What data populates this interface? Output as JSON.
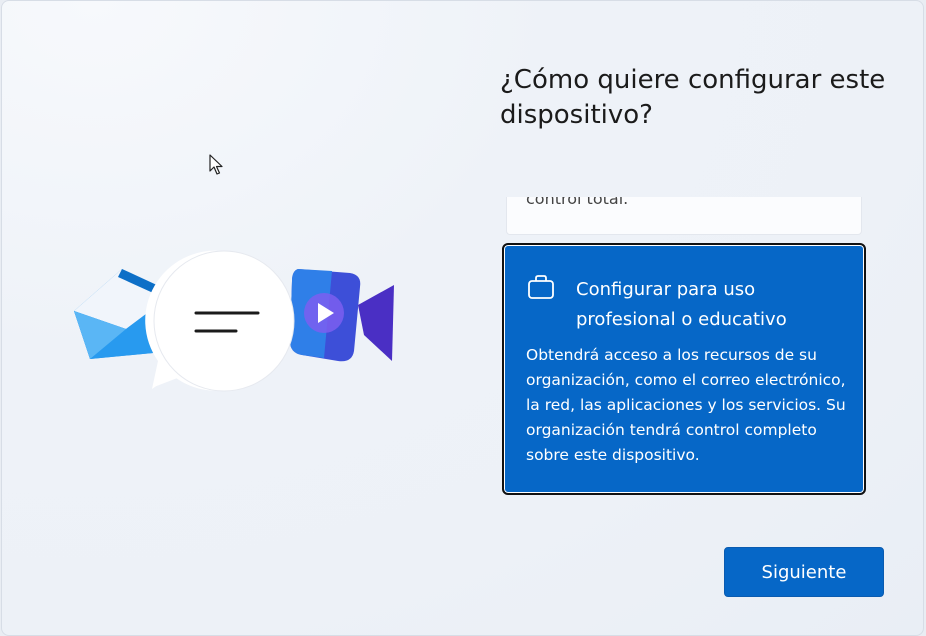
{
  "setup": {
    "title": "¿Cómo quiere configurar este dispositivo?",
    "options": [
      {
        "description_partial": "control total.",
        "selected": false
      },
      {
        "title": "Configurar para uso profesional o educativo",
        "description": "Obtendrá acceso a los recursos de su organización, como el correo electrónico, la red, las aplicaciones y los servicios. Su organización tendrá control completo sobre este dispositivo.",
        "icon": "briefcase-icon",
        "selected": true
      }
    ],
    "next_label": "Siguiente"
  },
  "colors": {
    "accent": "#0667c7",
    "background": "#eef2f8",
    "text": "#1b1b1b"
  },
  "illustration_icons": [
    "mail-icon",
    "chat-bubble-icon",
    "video-call-icon"
  ]
}
